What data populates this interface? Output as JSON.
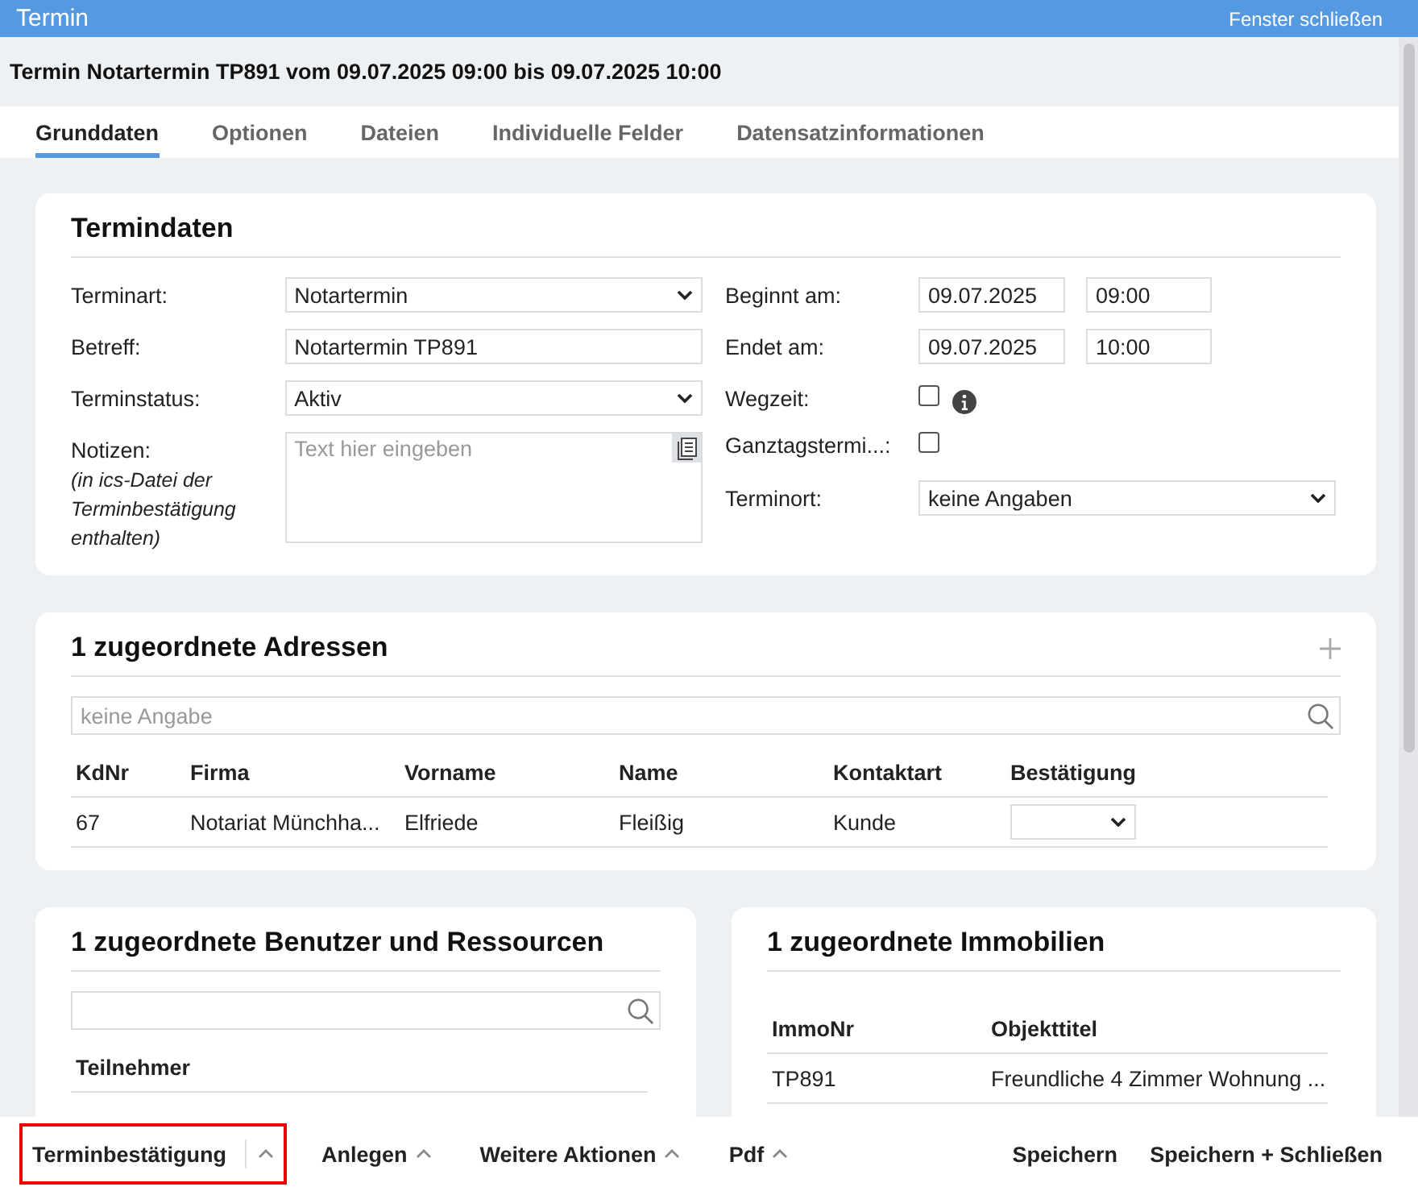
{
  "window": {
    "title": "Termin",
    "close_label": "Fenster schließen"
  },
  "heading": "Termin Notartermin TP891 vom 09.07.2025 09:00 bis 09.07.2025 10:00",
  "tabs": [
    {
      "label": "Grunddaten",
      "selected": true
    },
    {
      "label": "Optionen",
      "selected": false
    },
    {
      "label": "Dateien",
      "selected": false
    },
    {
      "label": "Individuelle Felder",
      "selected": false
    },
    {
      "label": "Datensatzinformationen",
      "selected": false
    }
  ],
  "termindaten": {
    "title": "Termindaten",
    "left_fields": [
      {
        "kind": "select",
        "label": "Terminart:",
        "value": "Notartermin"
      },
      {
        "kind": "input",
        "label": "Betreff:",
        "value": "Notartermin TP891"
      },
      {
        "kind": "select",
        "label": "Terminstatus:",
        "value": "Aktiv"
      },
      {
        "kind": "textarea",
        "label": "Notizen:",
        "note": "(in ics-Datei der Terminbestätigung enthalten)",
        "placeholder": "Text hier eingeben"
      }
    ],
    "right_fields": [
      {
        "kind": "datetime",
        "label": "Beginnt am:",
        "date": "09.07.2025",
        "time": "09:00"
      },
      {
        "kind": "datetime",
        "label": "Endet am:",
        "date": "09.07.2025",
        "time": "10:00"
      },
      {
        "kind": "checkbox",
        "label": "Wegzeit:",
        "checked": false,
        "info": true
      },
      {
        "kind": "checkbox",
        "label": "Ganztagstermi...:",
        "checked": false,
        "info": false
      },
      {
        "kind": "select",
        "label": "Terminort:",
        "value": "keine Angaben"
      }
    ]
  },
  "adressen": {
    "title": "1 zugeordnete Adressen",
    "search": {
      "placeholder": "keine Angabe"
    },
    "columns": [
      "KdNr",
      "Firma",
      "Vorname",
      "Name",
      "Kontaktart",
      "Bestätigung"
    ],
    "rows": [
      {
        "cells": [
          "67",
          "Notariat Münchha...",
          "Elfriede",
          "Fleißig",
          "Kunde"
        ],
        "confirmation": ""
      }
    ]
  },
  "benutzer": {
    "title": "1 zugeordnete Benutzer und Ressourcen",
    "columns": [
      "Teilnehmer"
    ]
  },
  "immobilien": {
    "title": "1 zugeordnete Immobilien",
    "columns": [
      "ImmoNr",
      "Objekttitel"
    ],
    "rows": [
      [
        "TP891",
        "Freundliche 4 Zimmer Wohnung ..."
      ]
    ]
  },
  "toolbar": {
    "left": [
      {
        "label": "Terminbestätigung",
        "kind": "split",
        "highlighted": true
      },
      {
        "label": "Anlegen",
        "kind": "menu",
        "highlighted": false
      },
      {
        "label": "Weitere Aktionen",
        "kind": "menu",
        "highlighted": false
      },
      {
        "label": "Pdf",
        "kind": "menu",
        "highlighted": false
      }
    ],
    "right": [
      "Speichern",
      "Speichern + Schließen"
    ]
  }
}
